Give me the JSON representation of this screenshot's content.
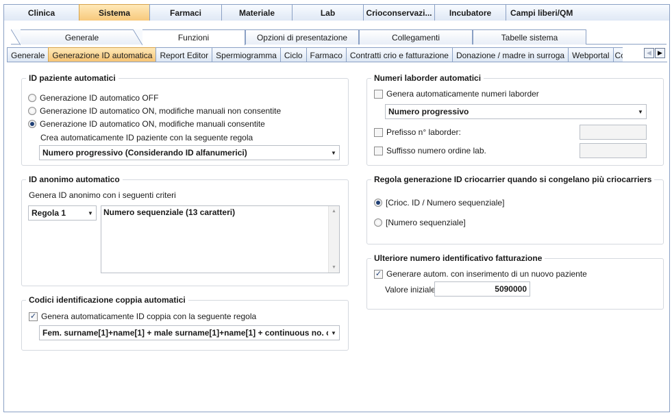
{
  "top_tabs": [
    "Clinica",
    "Sistema",
    "Farmaci",
    "Materiale",
    "Lab",
    "Crioconservazi...",
    "Incubatore",
    "Campi liberi/QM"
  ],
  "sub_tabs": [
    "Generale",
    "Funzioni",
    "Opzioni di presentazione",
    "Collegamenti",
    "Tabelle sistema"
  ],
  "third_tabs": [
    "Generale",
    "Generazione ID automatica",
    "Report Editor",
    "Spermiogramma",
    "Ciclo",
    "Farmaco",
    "Contratti crio e fatturazione",
    "Donazione / madre in surroga",
    "Webportal",
    "Co"
  ],
  "id_paziente": {
    "title": "ID paziente automatici",
    "radio_off": "Generazione ID automatico OFF",
    "radio_on_no_manual": "Generazione ID automatico ON, modifiche manuali non consentite",
    "radio_on_manual": "Generazione ID automatico ON, modifiche manuali consentite",
    "rule_label": "Crea automaticamente ID paziente con la seguente regola",
    "rule_value": "Numero progressivo (Considerando ID alfanumerici)"
  },
  "id_anonimo": {
    "title": "ID anonimo automatico",
    "criteria_label": "Genera ID anonimo con i seguenti criteri",
    "rule_select": "Regola 1",
    "list_item": "Numero sequenziale (13 caratteri)"
  },
  "codici_coppia": {
    "title": "Codici identificazione coppia automatici",
    "checkbox_label": "Genera automaticamente ID coppia con la seguente regola",
    "rule_value": "Fem. surname[1]+name[1] + male surname[1]+name[1] + continuous no. c"
  },
  "laborder": {
    "title": "Numeri laborder automatici",
    "checkbox_label": "Genera automaticamente numeri laborder",
    "select_value": "Numero progressivo",
    "prefix_label": "Prefisso n° laborder:",
    "suffix_label": "Suffisso numero ordine lab."
  },
  "criocarrier": {
    "title": "Regola generazione ID criocarrier quando si congelano più criocarriers",
    "option1": "[Crioc. ID / Numero sequenziale]",
    "option2": "[Numero sequenziale]"
  },
  "fatturazione": {
    "title": "Ulteriore numero identificativo fatturazione",
    "checkbox_label": "Generare autom. con inserimento di un nuovo paziente",
    "start_label": "Valore iniziale",
    "start_value": "5090000"
  }
}
